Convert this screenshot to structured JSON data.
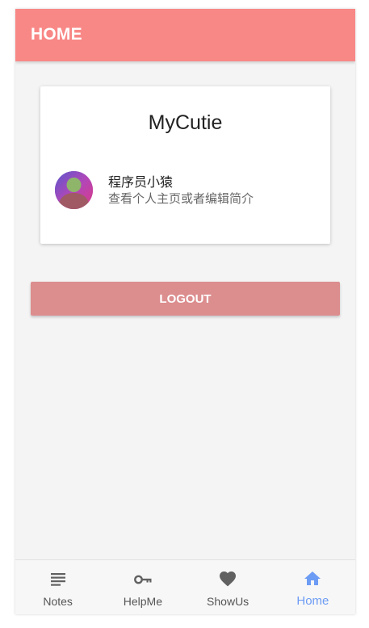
{
  "app_bar": {
    "title": "HOME",
    "color": "#f88886"
  },
  "card": {
    "title": "MyCutie",
    "profile": {
      "name": "程序员小猿",
      "subtitle": "查看个人主页或者编辑简介",
      "avatar_icon": "user-avatar"
    }
  },
  "logout_button": {
    "label": "LOGOUT",
    "color": "#dc8d8e"
  },
  "bottom_nav": {
    "active_color": "#6d9cf4",
    "items": [
      {
        "label": "Notes",
        "icon": "notes-icon",
        "active": false
      },
      {
        "label": "HelpMe",
        "icon": "key-icon",
        "active": false
      },
      {
        "label": "ShowUs",
        "icon": "heart-icon",
        "active": false
      },
      {
        "label": "Home",
        "icon": "home-icon",
        "active": true
      }
    ]
  }
}
